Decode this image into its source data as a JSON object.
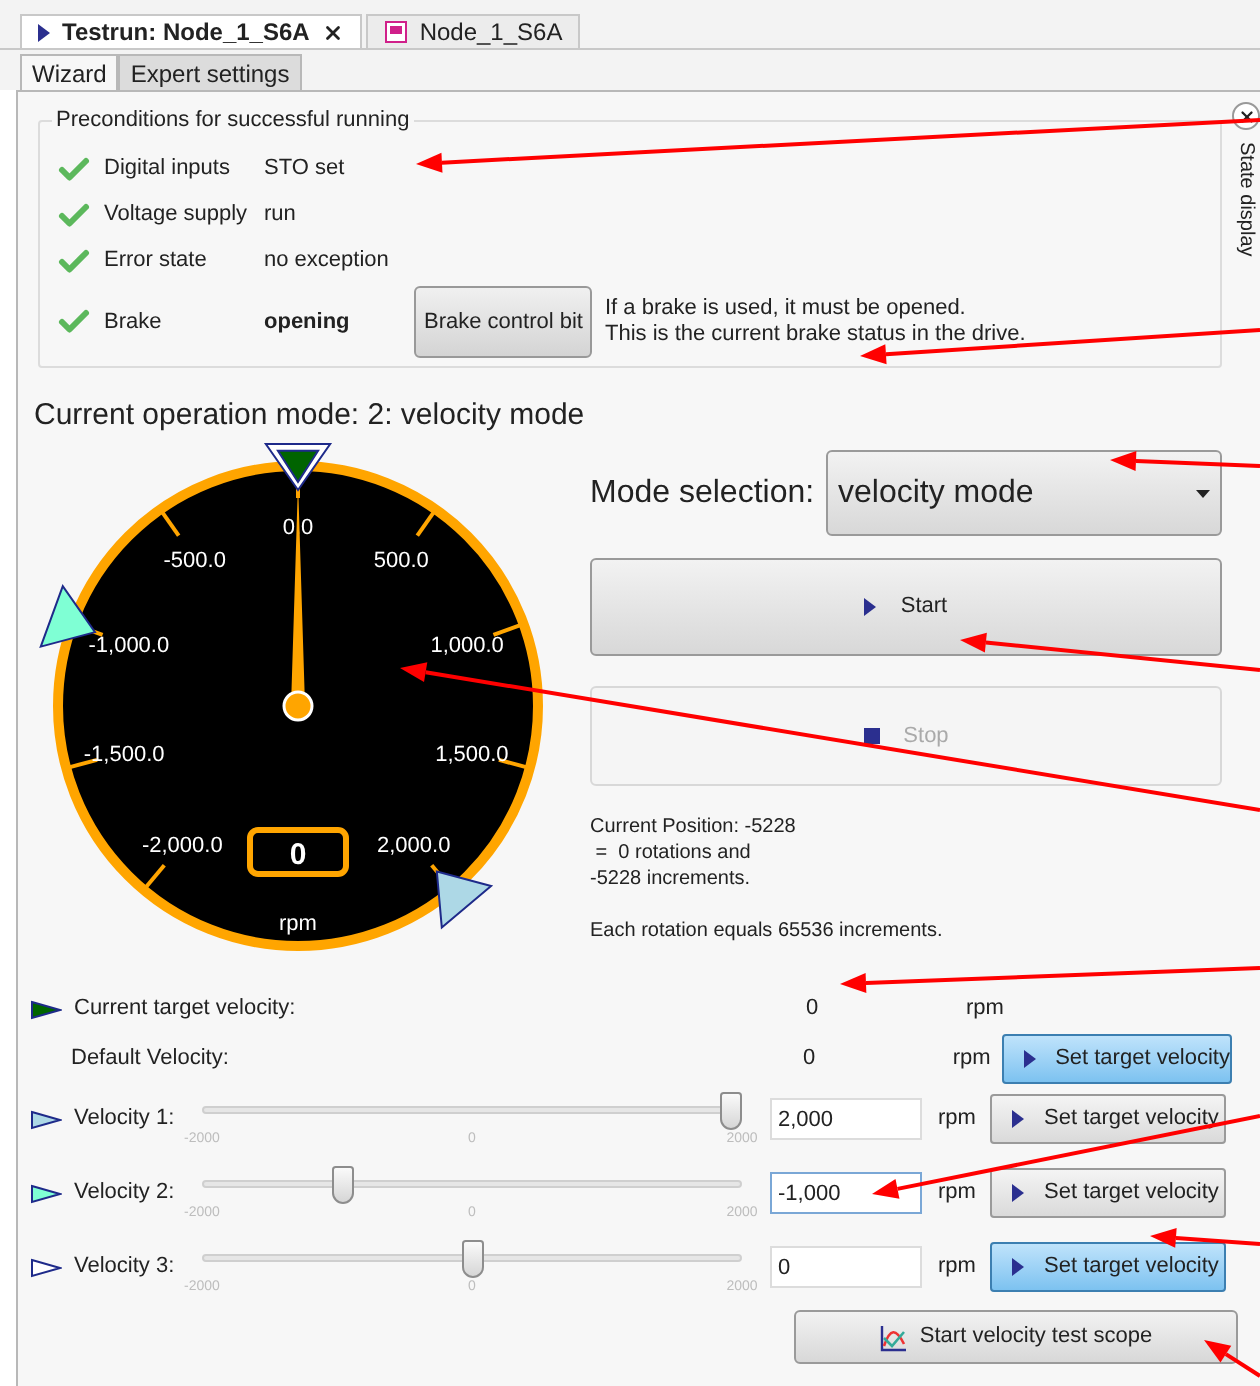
{
  "editor_tabs": [
    {
      "label": "Testrun: Node_1_S6A",
      "selected": true,
      "kind": "testrun"
    },
    {
      "label": "Node_1_S6A",
      "selected": false,
      "kind": "device"
    }
  ],
  "sub_tabs": [
    {
      "label": "Wizard",
      "selected": true
    },
    {
      "label": "Expert settings",
      "selected": false
    }
  ],
  "side_panel": {
    "label": "State display"
  },
  "preconditions": {
    "title": "Preconditions for successful running",
    "rows": [
      {
        "label": "Digital inputs",
        "value": "STO set",
        "ok": true,
        "emphasized": false
      },
      {
        "label": "Voltage supply",
        "value": "run",
        "ok": true,
        "emphasized": false
      },
      {
        "label": "Error state",
        "value": "no exception",
        "ok": true,
        "emphasized": false
      },
      {
        "label": "Brake",
        "value": "opening",
        "ok": true,
        "emphasized": true,
        "button": "Brake control bit",
        "note": [
          "If a brake is used, it must be opened.",
          "This is the current brake status in the drive."
        ]
      }
    ]
  },
  "operation_mode": {
    "title": "Current operation mode: 2: velocity mode"
  },
  "gauge": {
    "ticks": [
      "-2,000.0",
      "-1,500.0",
      "-1,000.0",
      "-500.0",
      "0.0",
      "500.0",
      "1,000.0",
      "1,500.0",
      "2,000.0"
    ],
    "readout": "0",
    "unit": "rpm"
  },
  "mode_selection": {
    "label": "Mode selection:",
    "value": "velocity mode"
  },
  "start_button": {
    "label": "Start",
    "disabled": false
  },
  "stop_button": {
    "label": "Stop",
    "disabled": true
  },
  "position_info": {
    "lines": [
      "Current Position: -5228",
      " =  0 rotations and",
      "-5228 increments."
    ],
    "note": "Each rotation equals 65536 increments."
  },
  "velocity_rows": [
    {
      "kind": "readout",
      "label": "Current target velocity:",
      "value": "0",
      "unit": "rpm",
      "color": "#006400"
    },
    {
      "kind": "default",
      "label": "Default Velocity:",
      "value": "0",
      "unit": "rpm",
      "button": {
        "label": "Set target velocity",
        "highlighted": true
      }
    },
    {
      "kind": "slider",
      "label": "Velocity 1:",
      "color": "#add8e6",
      "level": 1,
      "scale": [
        "-2000",
        "0",
        "2000"
      ],
      "value": "2,000",
      "focused": false,
      "unit": "rpm",
      "button": {
        "label": "Set target velocity",
        "highlighted": false
      }
    },
    {
      "kind": "slider",
      "label": "Velocity 2:",
      "color": "#7fffd4",
      "level": 0.25,
      "scale": [
        "-2000",
        "0",
        "2000"
      ],
      "value": "-1,000",
      "focused": true,
      "unit": "rpm",
      "button": {
        "label": "Set target velocity",
        "highlighted": false
      }
    },
    {
      "kind": "slider",
      "label": "Velocity 3:",
      "color": "#ffffff",
      "level": 0.5,
      "scale": [
        "-2000",
        "0",
        "2000"
      ],
      "value": "0",
      "focused": false,
      "unit": "rpm",
      "button": {
        "label": "Set target velocity",
        "highlighted": true
      }
    }
  ],
  "scope_button": {
    "label": "Start velocity test scope"
  }
}
